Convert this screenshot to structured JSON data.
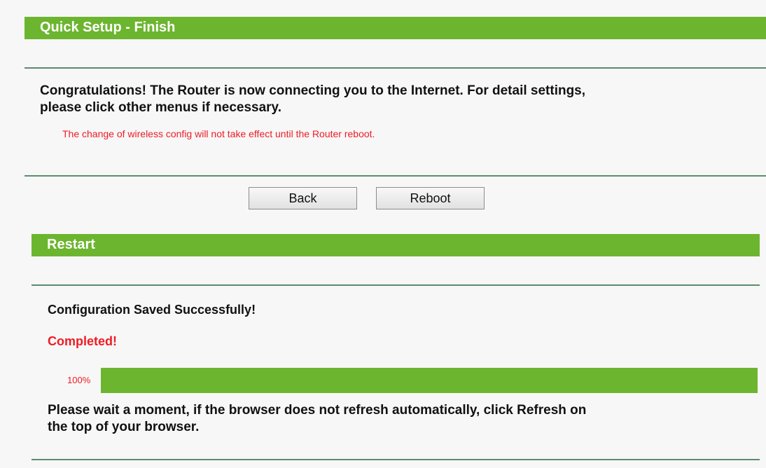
{
  "quick_setup": {
    "title": "Quick Setup - Finish",
    "congrats_line1": "Congratulations! The Router is now connecting you to the Internet. For detail settings,",
    "congrats_line2": "please click other menus if necessary.",
    "wireless_note": "The change of wireless config will not take effect until the Router reboot.",
    "back_label": "Back",
    "reboot_label": "Reboot"
  },
  "restart": {
    "title": "Restart",
    "saved_message": "Configuration Saved Successfully!",
    "completed": "Completed!",
    "progress_label": "100%",
    "progress_fraction": 1.0,
    "wait_line1": "Please wait a moment, if the browser does not refresh automatically, click Refresh on",
    "wait_line2": "the top of your browser."
  },
  "colors": {
    "accent_green": "#6cb52e",
    "alert_red": "#ee1c25",
    "divider": "#5b8c6c"
  }
}
